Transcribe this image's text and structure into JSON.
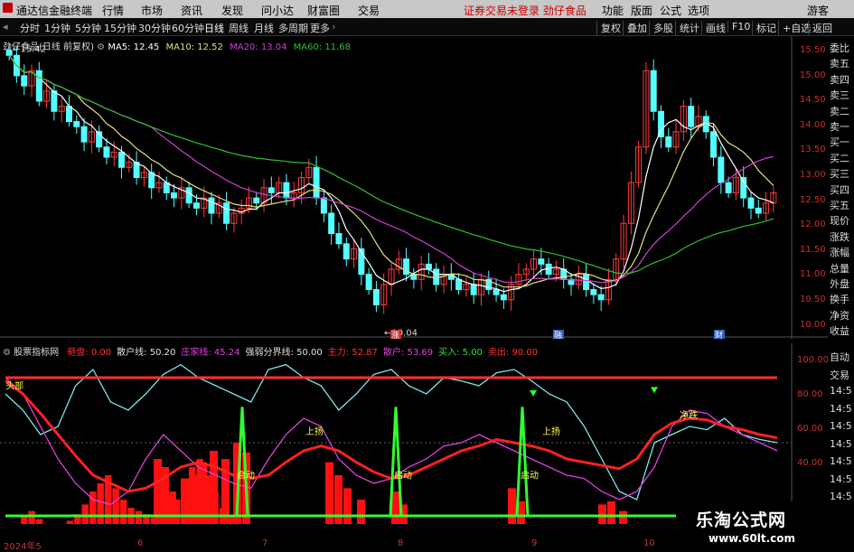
{
  "menubar": {
    "app_title": "通达信金融终端",
    "items": [
      "行情",
      "市场",
      "资讯",
      "发现",
      "问小达",
      "财富圈",
      "交易"
    ],
    "notice": "证券交易未登录  劲仔食品",
    "right_items": [
      "功能",
      "版面",
      "公式",
      "选项"
    ],
    "guest": "游客"
  },
  "toolbar": {
    "periods": [
      "分时",
      "1分钟",
      "5分钟",
      "15分钟",
      "30分钟",
      "60分钟",
      "日线",
      "周线",
      "月线",
      "多周期",
      "更多"
    ],
    "tools": [
      "复权",
      "叠加",
      "多股",
      "统计",
      "画线",
      "F10",
      "标记",
      "+自选",
      "返回"
    ]
  },
  "main_pane": {
    "title": "劲仔食品(日线 前复权)",
    "ma5": "MA5: 12.45",
    "ma10": "MA10: 12.52",
    "ma20": "MA20: 13.04",
    "ma60": "MA60: 11.68",
    "high_label": "15.42",
    "low_label": "10.04",
    "axis": [
      "15.50",
      "15.00",
      "14.50",
      "14.00",
      "13.50",
      "13.00",
      "12.50",
      "12.00",
      "11.50",
      "11.00",
      "10.50",
      "10.00"
    ],
    "markers": [
      "涨",
      "融",
      "财"
    ],
    "colors": {
      "up": "#ff3c3c",
      "down": "#54ffff",
      "ma5": "#ffffff",
      "ma10": "#e0e080",
      "ma20": "#d040d0",
      "ma60": "#30c030"
    }
  },
  "sub_pane": {
    "title": "股票指标网",
    "fields": [
      {
        "label": "砸盘: 0.00",
        "color": "#ff3030"
      },
      {
        "label": "散户线: 50.20",
        "color": "#e0e0e0"
      },
      {
        "label": "庄家线: 45.24",
        "color": "#e040e0"
      },
      {
        "label": "强弱分界线: 50.00",
        "color": "#e0e0e0"
      },
      {
        "label": "主力: 52.87",
        "color": "#ff3030"
      },
      {
        "label": "散户: 53.69",
        "color": "#e040e0"
      },
      {
        "label": "买入: 5.00",
        "color": "#30e030"
      },
      {
        "label": "卖出: 90.00",
        "color": "#ff3030"
      }
    ],
    "axis": [
      "100.00",
      "80.00",
      "60.00",
      "40.00"
    ],
    "annotations": [
      "头部",
      "上扬",
      "上扬",
      "启动",
      "启动",
      "启动",
      "净跌"
    ]
  },
  "right_panel": [
    "委比",
    "卖五",
    "卖四",
    "卖三",
    "卖二",
    "卖一",
    "买一",
    "买二",
    "买三",
    "买四",
    "买五",
    "现价",
    "涨跌",
    "涨幅",
    "总量",
    "外盘",
    "换手",
    "净资",
    "收益"
  ],
  "right_panel_sub": [
    "自动",
    "交易",
    "14:5",
    "14:5",
    "14:5",
    "14:5",
    "14:5",
    "14:5",
    "14:5"
  ],
  "xaxis": {
    "labels": [
      "2024年5",
      "6",
      "7",
      "8",
      "9",
      "10"
    ]
  },
  "watermark": {
    "name": "乐淘公式网",
    "url": "www.60lt.com"
  },
  "chart_data": [
    {
      "type": "candlestick",
      "title": "劲仔食品(日线 前复权)",
      "x": [
        "5月",
        "6月",
        "7月",
        "8月",
        "9月",
        "10月"
      ],
      "ylim": [
        10.0,
        15.5
      ],
      "close": [
        15.3,
        14.9,
        14.7,
        15.0,
        14.4,
        14.6,
        14.2,
        14.3,
        14.0,
        13.9,
        13.6,
        13.8,
        13.5,
        13.3,
        13.4,
        13.1,
        13.2,
        12.9,
        13.0,
        12.7,
        12.8,
        12.6,
        12.5,
        12.7,
        12.4,
        12.3,
        12.5,
        12.2,
        12.4,
        12.0,
        12.2,
        12.3,
        12.5,
        12.4,
        12.7,
        12.6,
        12.8,
        12.5,
        12.6,
        12.9,
        13.1,
        12.5,
        12.2,
        11.8,
        11.6,
        11.3,
        11.5,
        11.0,
        10.7,
        10.4,
        10.8,
        11.1,
        11.3,
        11.0,
        10.9,
        11.2,
        11.1,
        10.8,
        11.0,
        10.9,
        10.7,
        10.8,
        10.6,
        10.9,
        10.7,
        10.6,
        10.5,
        10.8,
        11.0,
        11.1,
        11.3,
        11.2,
        11.0,
        11.1,
        10.9,
        10.8,
        11.0,
        10.7,
        10.6,
        10.5,
        10.9,
        11.3,
        12.0,
        12.8,
        13.5,
        15.0,
        14.2,
        13.7,
        13.5,
        13.8,
        14.3,
        13.9,
        14.1,
        13.8,
        13.3,
        12.8,
        12.6,
        12.9,
        12.5,
        12.3,
        12.2,
        12.4,
        12.6
      ],
      "ma60_end": 11.68
    },
    {
      "type": "line",
      "title": "股票指标网",
      "ylim": [
        0,
        100
      ],
      "series": [
        {
          "name": "散户线",
          "values": [
            80,
            70,
            55,
            60,
            85,
            95,
            75,
            70,
            80,
            92,
            98,
            90,
            85,
            80,
            75,
            95,
            98,
            90,
            85,
            70,
            80,
            92,
            95,
            85,
            80,
            90,
            88,
            85,
            93,
            95,
            88,
            80,
            75,
            60,
            40,
            20,
            15,
            50,
            55,
            60,
            58,
            65,
            55,
            52,
            50
          ]
        },
        {
          "name": "庄家线",
          "values": [
            90,
            80,
            60,
            40,
            25,
            15,
            12,
            20,
            40,
            55,
            45,
            35,
            30,
            25,
            22,
            40,
            55,
            65,
            60,
            40,
            30,
            25,
            28,
            35,
            40,
            48,
            50,
            55,
            50,
            45,
            40,
            35,
            30,
            28,
            20,
            15,
            20,
            35,
            60,
            70,
            68,
            60,
            55,
            50,
            45
          ]
        },
        {
          "name": "主力",
          "values": [
            88,
            80,
            68,
            55,
            42,
            30,
            25,
            20,
            22,
            28,
            35,
            38,
            35,
            30,
            28,
            30,
            38,
            45,
            48,
            45,
            38,
            32,
            28,
            30,
            35,
            40,
            45,
            48,
            52,
            50,
            48,
            45,
            40,
            38,
            36,
            34,
            40,
            55,
            62,
            65,
            64,
            60,
            58,
            55,
            53
          ]
        },
        {
          "name": "卖出",
          "values": [
            90,
            90,
            90,
            90,
            90,
            90,
            90,
            90,
            90,
            90,
            90,
            90,
            90,
            90,
            90,
            90,
            90,
            90,
            90,
            90,
            90,
            90,
            90,
            90,
            90,
            90,
            90,
            90,
            90,
            90,
            90,
            90,
            90,
            90,
            90,
            90,
            90,
            90,
            90,
            90,
            90,
            90,
            90,
            90,
            90
          ]
        },
        {
          "name": "买入",
          "values": [
            5,
            5,
            5,
            5,
            5,
            5,
            5,
            5,
            5,
            5,
            5,
            5,
            5,
            5,
            5,
            5,
            5,
            5,
            5,
            5,
            5,
            5,
            5,
            5,
            5,
            5,
            5,
            5,
            5,
            5,
            5,
            5,
            5,
            5,
            5,
            5,
            5,
            5,
            5,
            5,
            5,
            5,
            5,
            5,
            5
          ]
        }
      ],
      "spikes_at": [
        13,
        21,
        28
      ],
      "bars": [
        0,
        0,
        5,
        8,
        3,
        0,
        0,
        0,
        2,
        6,
        12,
        20,
        25,
        30,
        22,
        15,
        10,
        8,
        6,
        4,
        2,
        0,
        15,
        28,
        35,
        40,
        30,
        20,
        10,
        5,
        0,
        0,
        0,
        0,
        0,
        0,
        0,
        0,
        0,
        0,
        0,
        0,
        0,
        0,
        0,
        0,
        0,
        0,
        0,
        0,
        0,
        0,
        0,
        0,
        0,
        0,
        0,
        0,
        0,
        0,
        0,
        0,
        0,
        0,
        0,
        0,
        0,
        0,
        0,
        0,
        0,
        0,
        0,
        0,
        0,
        0,
        0,
        0,
        0,
        0,
        0,
        0,
        0,
        0,
        0,
        0,
        0,
        0,
        0,
        0,
        0,
        0,
        0,
        0,
        0,
        0,
        0,
        0,
        0,
        0,
        0
      ]
    }
  ]
}
